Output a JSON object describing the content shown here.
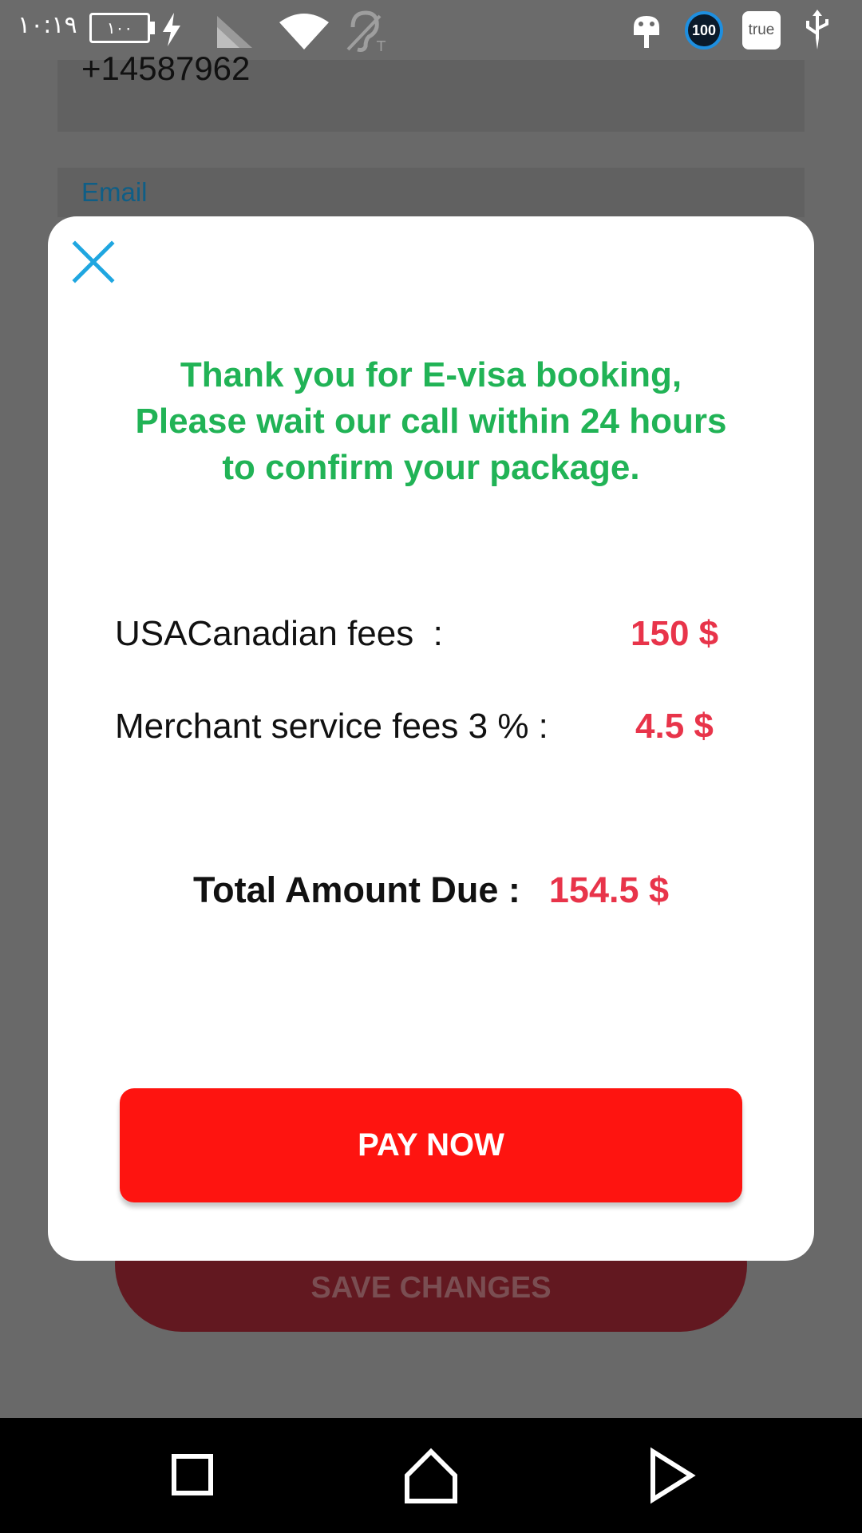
{
  "status_bar": {
    "time": "١٠:١٩",
    "battery_level": "١٠٠",
    "badge_100": "100",
    "badge_true": "true",
    "icons": [
      "charging-bolt-icon",
      "cell-signal-icon",
      "wifi-icon",
      "hearing-aid-icon",
      "android-icon",
      "usb-icon"
    ]
  },
  "background_form": {
    "phone_value": "+14587962",
    "email_label": "Email",
    "save_button_label": "SAVE CHANGES"
  },
  "modal": {
    "close_icon": "close-icon",
    "thanks_lines": [
      "Thank you for E-visa booking,",
      "Please wait our call within 24 hours",
      "to confirm your package."
    ],
    "fees": [
      {
        "label": "USACanadian fees  :",
        "value": "150 $"
      },
      {
        "label": "Merchant service fees 3 % :",
        "value": "4.5 $"
      }
    ],
    "total_label": "Total Amount Due :",
    "total_value": "154.5 $",
    "pay_button_label": "PAY NOW"
  },
  "nav_bar": {
    "icons": [
      "recent-apps-icon",
      "home-icon",
      "back-icon"
    ]
  },
  "colors": {
    "accent_green": "#21b356",
    "amount_red": "#e8344a",
    "pay_button_red": "#fe1410",
    "close_icon_blue": "#1fa6e0",
    "overlay_gray": "#696969"
  }
}
